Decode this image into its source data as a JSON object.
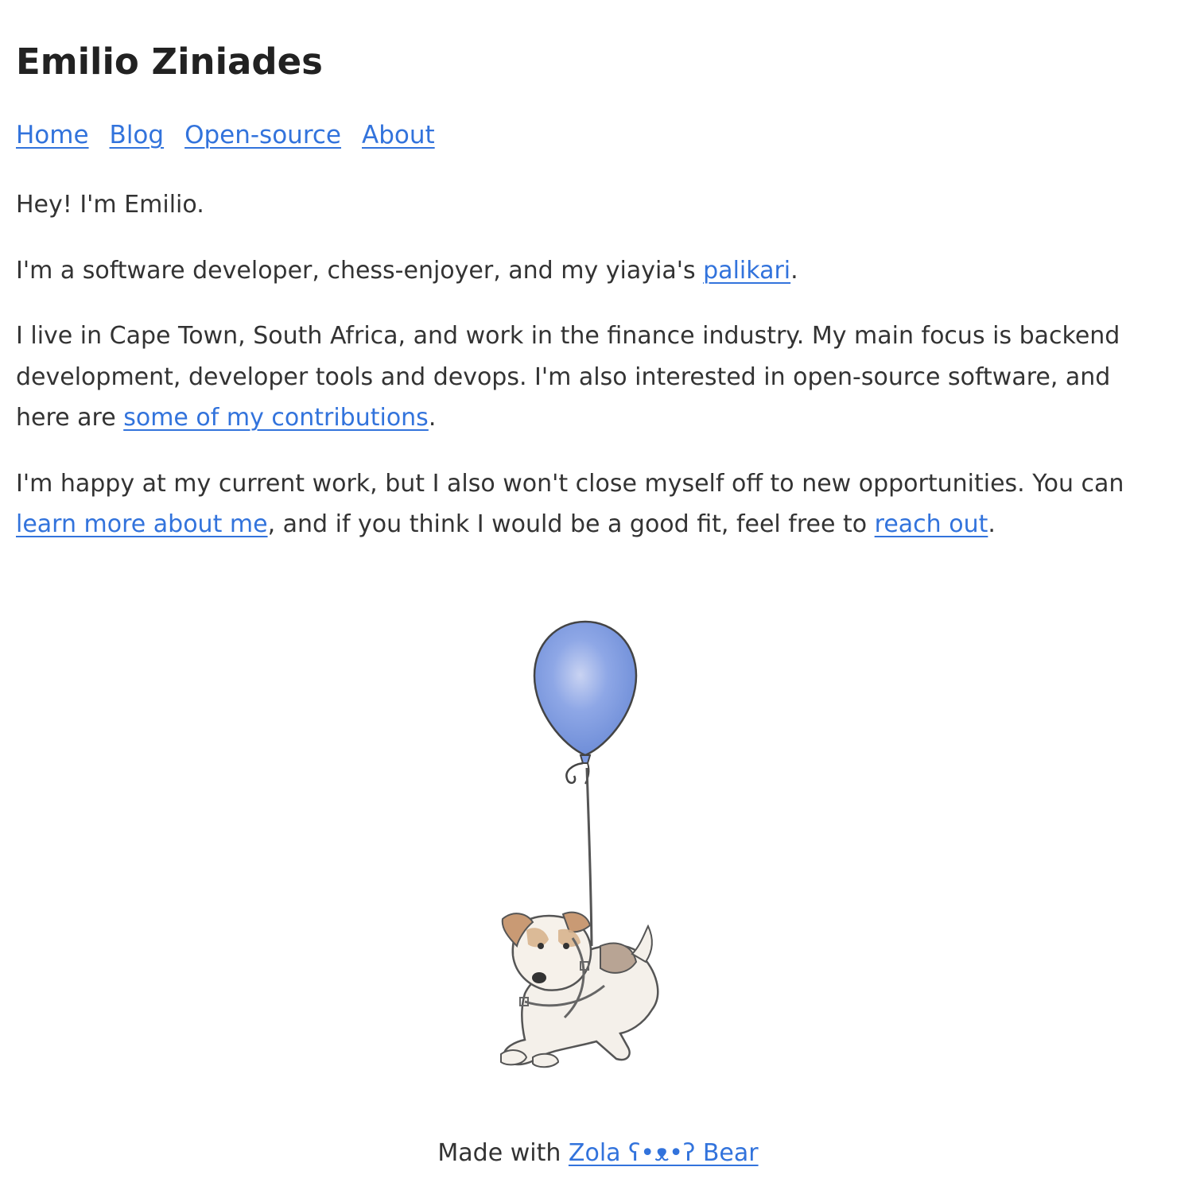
{
  "header": {
    "title": "Emilio Ziniades"
  },
  "nav": {
    "items": [
      {
        "label": "Home"
      },
      {
        "label": "Blog"
      },
      {
        "label": "Open-source"
      },
      {
        "label": "About"
      }
    ]
  },
  "content": {
    "greeting": "Hey! I'm Emilio.",
    "p2": {
      "before": "I'm a software developer, chess-enjoyer, and my yiayia's ",
      "link": "palikari",
      "after": "."
    },
    "p3": {
      "before": "I live in Cape Town, South Africa, and work in the finance industry. My main focus is backend development, developer tools and devops. I'm also interested in open-source software, and here are ",
      "link": "some of my contributions",
      "after": "."
    },
    "p4": {
      "before": "I'm happy at my current work, but I also won't close myself off to new opportunities. You can ",
      "link1": "learn more about me",
      "middle": ", and if you think I would be a good fit, feel free to ",
      "link2": "reach out",
      "after": "."
    }
  },
  "illustration": {
    "icon": "dog-with-balloon-illustration",
    "balloon_color": "#7d9ae0"
  },
  "footer": {
    "prefix": "Made with ",
    "link": "Zola ʕ•ᴥ•ʔ Bear"
  },
  "colors": {
    "link": "#3273dc",
    "text": "#333333",
    "title": "#222222",
    "background": "#ffffff"
  }
}
